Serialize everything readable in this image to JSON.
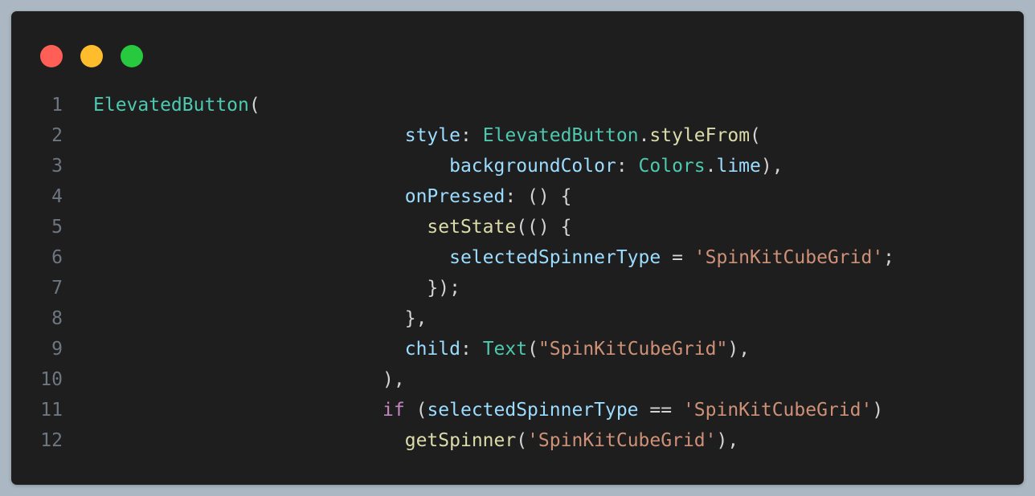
{
  "window": {
    "controls": [
      {
        "name": "close",
        "color": "#ff5f56"
      },
      {
        "name": "minimize",
        "color": "#ffbd2e"
      },
      {
        "name": "zoom",
        "color": "#27c93f"
      }
    ]
  },
  "colors": {
    "background": "#abb8c3",
    "editor": "#1e1e1e",
    "line_number": "#6e7681",
    "type": "#4ec9b0",
    "property": "#9cdcfe",
    "function": "#dcdcaa",
    "string": "#ce9178",
    "keyword": "#c586c0",
    "punctuation": "#d4d4d4"
  },
  "code": {
    "lines": [
      {
        "number": "1",
        "indent": "",
        "tokens": [
          {
            "t": "ElevatedButton",
            "k": "type"
          },
          {
            "t": "(",
            "k": "punc"
          }
        ]
      },
      {
        "number": "2",
        "indent": "                            ",
        "tokens": [
          {
            "t": "style",
            "k": "prop"
          },
          {
            "t": ": ",
            "k": "punc"
          },
          {
            "t": "ElevatedButton",
            "k": "type"
          },
          {
            "t": ".",
            "k": "punc"
          },
          {
            "t": "styleFrom",
            "k": "fn"
          },
          {
            "t": "(",
            "k": "punc"
          }
        ]
      },
      {
        "number": "3",
        "indent": "                                ",
        "tokens": [
          {
            "t": "backgroundColor",
            "k": "prop"
          },
          {
            "t": ": ",
            "k": "punc"
          },
          {
            "t": "Colors",
            "k": "type"
          },
          {
            "t": ".",
            "k": "punc"
          },
          {
            "t": "lime",
            "k": "prop"
          },
          {
            "t": "),",
            "k": "punc"
          }
        ]
      },
      {
        "number": "4",
        "indent": "                            ",
        "tokens": [
          {
            "t": "onPressed",
            "k": "prop"
          },
          {
            "t": ": () {",
            "k": "punc"
          }
        ]
      },
      {
        "number": "5",
        "indent": "                              ",
        "tokens": [
          {
            "t": "setState",
            "k": "fn"
          },
          {
            "t": "(() {",
            "k": "punc"
          }
        ]
      },
      {
        "number": "6",
        "indent": "                                ",
        "tokens": [
          {
            "t": "selectedSpinnerType",
            "k": "prop"
          },
          {
            "t": " = ",
            "k": "punc"
          },
          {
            "t": "'SpinKitCubeGrid'",
            "k": "str"
          },
          {
            "t": ";",
            "k": "punc"
          }
        ]
      },
      {
        "number": "7",
        "indent": "                              ",
        "tokens": [
          {
            "t": "});",
            "k": "punc"
          }
        ]
      },
      {
        "number": "8",
        "indent": "                            ",
        "tokens": [
          {
            "t": "},",
            "k": "punc"
          }
        ]
      },
      {
        "number": "9",
        "indent": "                            ",
        "tokens": [
          {
            "t": "child",
            "k": "prop"
          },
          {
            "t": ": ",
            "k": "punc"
          },
          {
            "t": "Text",
            "k": "type"
          },
          {
            "t": "(",
            "k": "punc"
          },
          {
            "t": "\"SpinKitCubeGrid\"",
            "k": "str"
          },
          {
            "t": "),",
            "k": "punc"
          }
        ]
      },
      {
        "number": "10",
        "indent": "                          ",
        "tokens": [
          {
            "t": "),",
            "k": "punc"
          }
        ]
      },
      {
        "number": "11",
        "indent": "                          ",
        "tokens": [
          {
            "t": "if",
            "k": "kw"
          },
          {
            "t": " (",
            "k": "punc"
          },
          {
            "t": "selectedSpinnerType",
            "k": "prop"
          },
          {
            "t": " == ",
            "k": "punc"
          },
          {
            "t": "'SpinKitCubeGrid'",
            "k": "str"
          },
          {
            "t": ")",
            "k": "punc"
          }
        ]
      },
      {
        "number": "12",
        "indent": "                            ",
        "tokens": [
          {
            "t": "getSpinner",
            "k": "fn"
          },
          {
            "t": "(",
            "k": "punc"
          },
          {
            "t": "'SpinKitCubeGrid'",
            "k": "str"
          },
          {
            "t": "),",
            "k": "punc"
          }
        ]
      }
    ]
  }
}
